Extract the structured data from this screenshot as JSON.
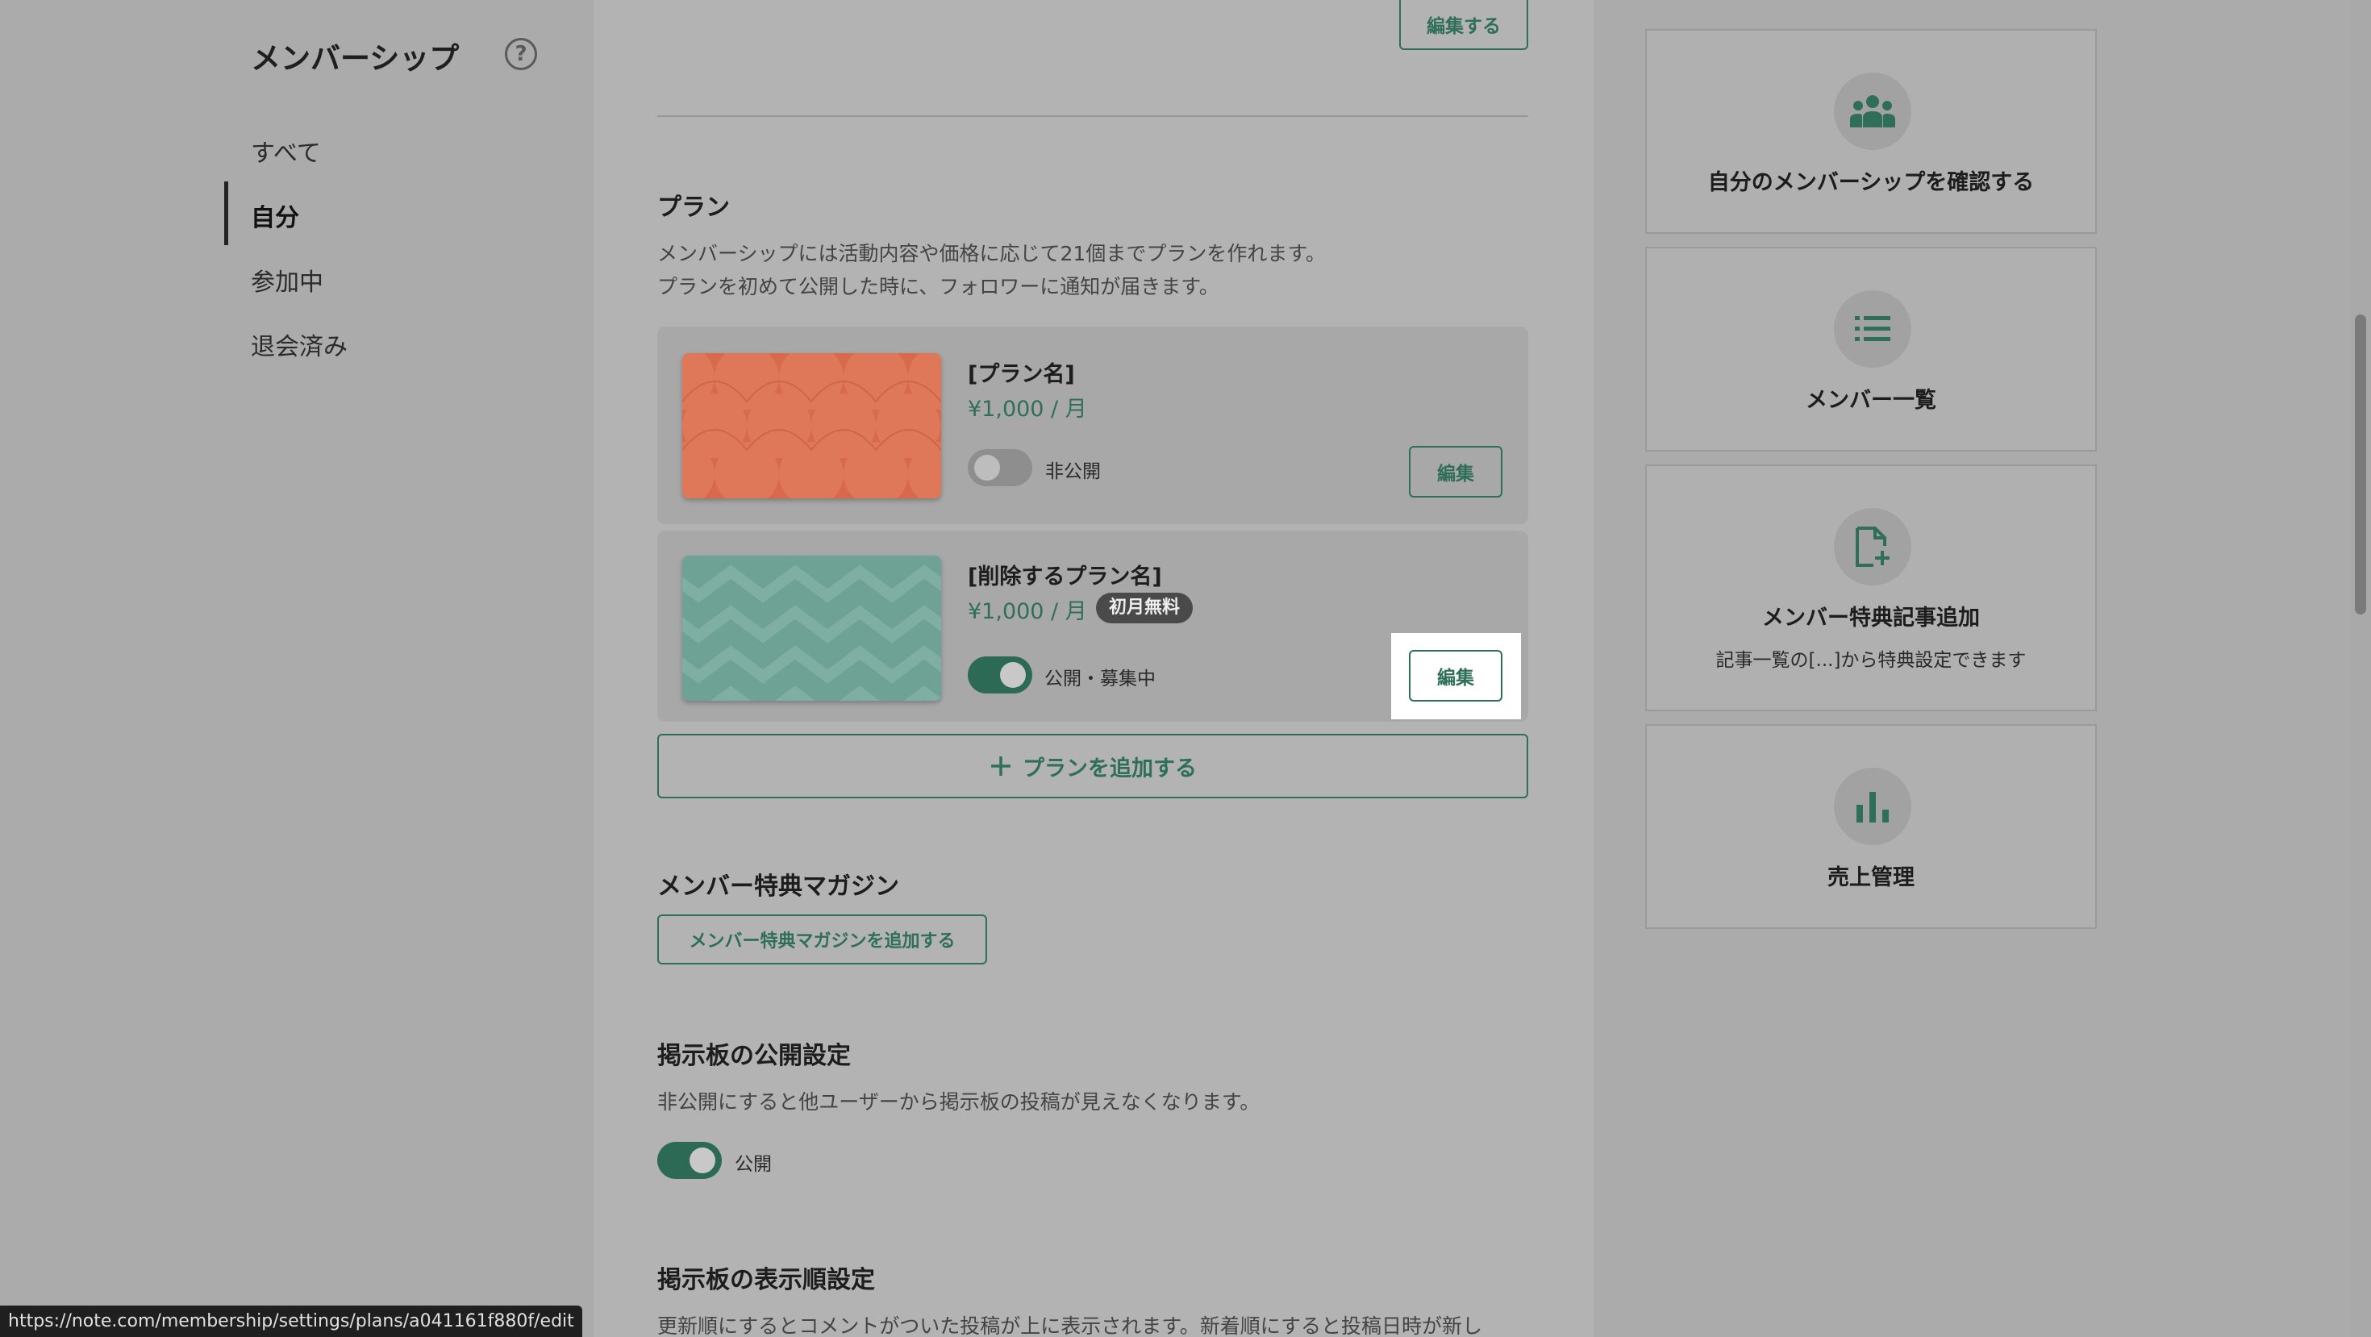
{
  "sidebar": {
    "title": "メンバーシップ",
    "help_icon": "question-circle-icon",
    "nav": [
      {
        "label": "すべて",
        "active": false
      },
      {
        "label": "自分",
        "active": true
      },
      {
        "label": "参加中",
        "active": false
      },
      {
        "label": "退会済み",
        "active": false
      }
    ]
  },
  "main": {
    "top_edit_button": "編集する",
    "plans": {
      "heading": "プラン",
      "desc_line1": "メンバーシップには活動内容や価格に応じて21個までプランを作れます。",
      "desc_line2": "プランを初めて公開した時に、フォロワーに通知が届きます。",
      "items": [
        {
          "name": "[プラン名]",
          "price": "¥1,000 / 月",
          "badge": "",
          "status": "非公開",
          "status_on": false,
          "edit_label": "編集",
          "thumb_color": "#d9694b"
        },
        {
          "name": "[削除するプラン名]",
          "price": "¥1,000 / 月",
          "badge": "初月無料",
          "status": "公開・募集中",
          "status_on": true,
          "edit_label": "編集",
          "thumb_color": "#6ea295"
        }
      ],
      "add_button": "プランを追加する"
    },
    "magazine": {
      "heading": "メンバー特典マガジン",
      "add_button": "メンバー特典マガジンを追加する"
    },
    "board_visibility": {
      "heading": "掲示板の公開設定",
      "desc": "非公開にすると他ユーザーから掲示板の投稿が見えなくなります。",
      "toggle_label": "公開",
      "toggle_on": true
    },
    "board_order": {
      "heading": "掲示板の表示順設定",
      "desc": "更新順にするとコメントがついた投稿が上に表示されます。新着順にすると投稿日時が新し"
    }
  },
  "right": {
    "cards": [
      {
        "icon": "people-icon",
        "label": "自分のメンバーシップを確認する",
        "sub": ""
      },
      {
        "icon": "list-icon",
        "label": "メンバー一覧",
        "sub": ""
      },
      {
        "icon": "file-add-icon",
        "label": "メンバー特典記事追加",
        "sub": "記事一覧の[...]から特典設定できます"
      },
      {
        "icon": "bar-chart-icon",
        "label": "売上管理",
        "sub": ""
      }
    ]
  },
  "status_url": "https://note.com/membership/settings/plans/a041161f880f/edit",
  "colors": {
    "accent": "#2f6f5a",
    "overlay": "#b3b3b3",
    "highlight": "#ffffff"
  }
}
